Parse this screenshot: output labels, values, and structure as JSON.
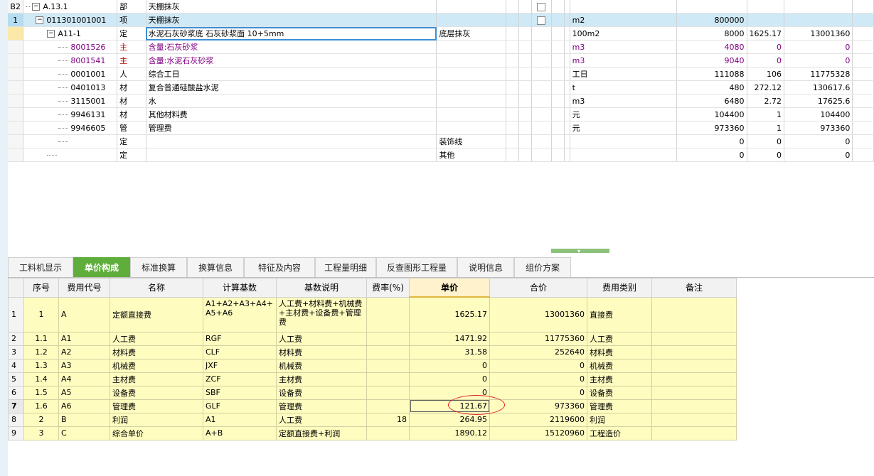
{
  "top_grid": {
    "rows": [
      {
        "rownum": "B2",
        "code": "A.13.1",
        "code_box": "−",
        "type": "部",
        "name": "天棚抹灰",
        "item_feature": "",
        "unit": "",
        "qty": "",
        "price": "",
        "total": ""
      },
      {
        "rownum": "1",
        "code": "011301001001",
        "code_box": "−",
        "type": "项",
        "name": "天棚抹灰",
        "item_feature": "",
        "unit": "m2",
        "qty": "800000",
        "price": "",
        "total": ""
      },
      {
        "rownum": "",
        "code": "A11-1",
        "code_box": "−",
        "type": "定",
        "name": "水泥石灰砂浆底 石灰砂浆面 10+5mm",
        "item_feature": "底层抹灰",
        "unit": "100m2",
        "qty": "8000",
        "price": "1625.17",
        "total": "13001360"
      },
      {
        "rownum": "",
        "code": "8001526",
        "type": "主",
        "name": "含量:石灰砂浆",
        "item_feature": "",
        "unit": "m3",
        "qty": "4080",
        "price": "0",
        "total": "0"
      },
      {
        "rownum": "",
        "code": "8001541",
        "type": "主",
        "name": "含量:水泥石灰砂浆",
        "item_feature": "",
        "unit": "m3",
        "qty": "9040",
        "price": "0",
        "total": "0"
      },
      {
        "rownum": "",
        "code": "0001001",
        "type": "人",
        "name": "综合工日",
        "item_feature": "",
        "unit": "工日",
        "qty": "111088",
        "price": "106",
        "total": "11775328"
      },
      {
        "rownum": "",
        "code": "0401013",
        "type": "材",
        "name": "复合普通硅酸盐水泥",
        "item_feature": "",
        "unit": "t",
        "qty": "480",
        "price": "272.12",
        "total": "130617.6"
      },
      {
        "rownum": "",
        "code": "3115001",
        "type": "材",
        "name": "水",
        "item_feature": "",
        "unit": "m3",
        "qty": "6480",
        "price": "2.72",
        "total": "17625.6"
      },
      {
        "rownum": "",
        "code": "9946131",
        "type": "材",
        "name": "其他材料费",
        "item_feature": "",
        "unit": "元",
        "qty": "104400",
        "price": "1",
        "total": "104400"
      },
      {
        "rownum": "",
        "code": "9946605",
        "type": "管",
        "name": "管理费",
        "item_feature": "",
        "unit": "元",
        "qty": "973360",
        "price": "1",
        "total": "973360"
      },
      {
        "rownum": "",
        "code": "",
        "type": "定",
        "name": "",
        "item_feature": "装饰线",
        "unit": "",
        "qty": "0",
        "price": "0",
        "total": "0"
      },
      {
        "rownum": "",
        "code": "",
        "type": "定",
        "name": "",
        "item_feature": "其他",
        "unit": "",
        "qty": "0",
        "price": "0",
        "total": "0"
      }
    ]
  },
  "tabs": [
    "工料机显示",
    "单价构成",
    "标准换算",
    "换算信息",
    "特征及内容",
    "工程量明细",
    "反查图形工程量",
    "说明信息",
    "组价方案"
  ],
  "active_tab": "单价构成",
  "bottom_grid": {
    "headers": [
      "序号",
      "费用代号",
      "名称",
      "计算基数",
      "基数说明",
      "费率(%)",
      "单价",
      "合价",
      "费用类别",
      "备注"
    ],
    "rows": [
      {
        "rn": "1",
        "seq": "1",
        "code": "A",
        "name": "定额直接费",
        "base": "A1+A2+A3+A4+A5+A6",
        "base_desc": "人工费+材料费+机械费+主材费+设备费+管理费",
        "rate": "",
        "unit_price": "1625.17",
        "total": "13001360",
        "category": "直接费",
        "remark": ""
      },
      {
        "rn": "2",
        "seq": "1.1",
        "code": "A1",
        "name": "人工费",
        "base": "RGF",
        "base_desc": "人工费",
        "rate": "",
        "unit_price": "1471.92",
        "total": "11775360",
        "category": "人工费",
        "remark": ""
      },
      {
        "rn": "3",
        "seq": "1.2",
        "code": "A2",
        "name": "材料费",
        "base": "CLF",
        "base_desc": "材料费",
        "rate": "",
        "unit_price": "31.58",
        "total": "252640",
        "category": "材料费",
        "remark": ""
      },
      {
        "rn": "4",
        "seq": "1.3",
        "code": "A3",
        "name": "机械费",
        "base": "JXF",
        "base_desc": "机械费",
        "rate": "",
        "unit_price": "0",
        "total": "0",
        "category": "机械费",
        "remark": ""
      },
      {
        "rn": "5",
        "seq": "1.4",
        "code": "A4",
        "name": "主材费",
        "base": "ZCF",
        "base_desc": "主材费",
        "rate": "",
        "unit_price": "0",
        "total": "0",
        "category": "主材费",
        "remark": ""
      },
      {
        "rn": "6",
        "seq": "1.5",
        "code": "A5",
        "name": "设备费",
        "base": "SBF",
        "base_desc": "设备费",
        "rate": "",
        "unit_price": "0",
        "total": "0",
        "category": "设备费",
        "remark": ""
      },
      {
        "rn": "7",
        "seq": "1.6",
        "code": "A6",
        "name": "管理费",
        "base": "GLF",
        "base_desc": "管理费",
        "rate": "",
        "unit_price": "121.67",
        "total": "973360",
        "category": "管理费",
        "remark": ""
      },
      {
        "rn": "8",
        "seq": "2",
        "code": "B",
        "name": "利润",
        "base": "A1",
        "base_desc": "人工费",
        "rate": "18",
        "unit_price": "264.95",
        "total": "2119600",
        "category": "利润",
        "remark": ""
      },
      {
        "rn": "9",
        "seq": "3",
        "code": "C",
        "name": "综合单价",
        "base": "A+B",
        "base_desc": "定额直接费+利润",
        "rate": "",
        "unit_price": "1890.12",
        "total": "15120960",
        "category": "工程造价",
        "remark": ""
      }
    ]
  },
  "colors": {
    "selected_row": "#cfe9f6",
    "active_tab": "#5fae3c",
    "bottom_cell": "#fffcc0",
    "purple_text": "#800080",
    "annotation_circle": "#e02020"
  }
}
